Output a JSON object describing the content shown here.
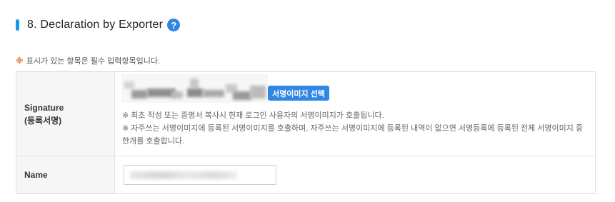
{
  "section": {
    "title": "8. Declaration by Exporter",
    "help_icon": "?"
  },
  "required_note": {
    "star": "※",
    "text": "표시가 있는 항목은 필수 입력항목입니다."
  },
  "form": {
    "signature": {
      "label_line1": "Signature",
      "label_line2": "(등록서명)",
      "select_button": "서명이미지 선택",
      "note1": "※ 최초 작성 또는 증명서 복사시 현재 로그인 사용자의 서명이미지가 호출됩니다.",
      "note2": "※ 자주쓰는 서명이미지에 등록된 서명이미지를 호출하며, 자주쓰는 서명이미지에 등록된 내역이 없으면 서명등록에 등록된 전체 서명이미지 중 한개를 호출합니다."
    },
    "name": {
      "label": "Name"
    }
  },
  "colors": {
    "accent": "#2f86e4",
    "title_bar": "#1e96e6",
    "required_star": "#e8682c",
    "label_bg": "#f6f6f6"
  }
}
